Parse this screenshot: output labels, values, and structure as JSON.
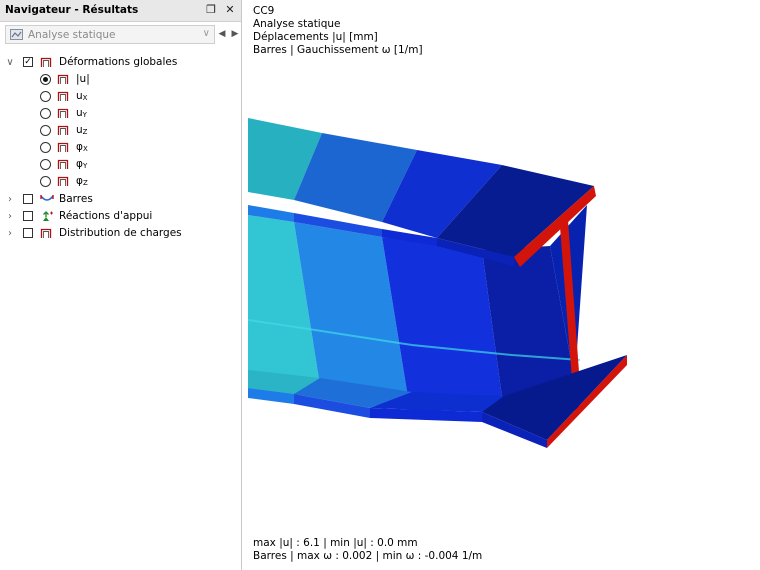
{
  "navigator": {
    "title": "Navigateur - Résultats",
    "dropdown": {
      "value": "Analyse statique"
    },
    "tree": {
      "global_deformations": {
        "label": "Déformations globales",
        "checked": true
      },
      "options": [
        {
          "label": "|u|",
          "selected": true
        },
        {
          "label": "u",
          "sub": "X",
          "selected": false
        },
        {
          "label": "u",
          "sub": "Y",
          "selected": false
        },
        {
          "label": "u",
          "sub": "Z",
          "selected": false
        },
        {
          "label": "φ",
          "sub": "X",
          "selected": false
        },
        {
          "label": "φ",
          "sub": "Y",
          "selected": false
        },
        {
          "label": "φ",
          "sub": "Z",
          "selected": false
        }
      ],
      "groups": [
        {
          "label": "Barres",
          "icon": "member-icon"
        },
        {
          "label": "Réactions d'appui",
          "icon": "support-reaction-icon"
        },
        {
          "label": "Distribution de charges",
          "icon": "load-distribution-icon"
        }
      ]
    }
  },
  "viewport": {
    "header": [
      "CC9",
      "Analyse statique",
      "Déplacements |u| [mm]",
      "Barres | Gauchissement ω [1/m]"
    ],
    "footer": [
      "max |u| : 6.1 | min |u| : 0.0 mm",
      "Barres | max ω : 0.002 | min ω : -0.004 1/m"
    ],
    "colors": {
      "edge": "#d2140a",
      "bands": [
        "#2ab3c8",
        "#1e6fd8",
        "#0e2fd0",
        "#061a8e"
      ]
    }
  }
}
